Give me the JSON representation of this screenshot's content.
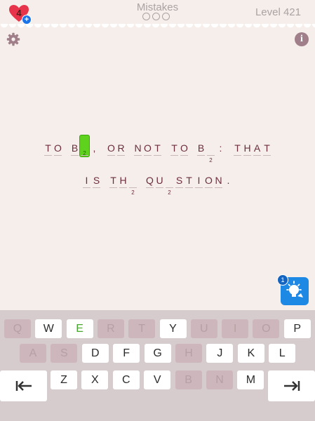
{
  "header": {
    "lives": "4",
    "plus": "+",
    "mistakes_label": "Mistakes",
    "level_label": "Level 421"
  },
  "info_label": "i",
  "hint_count": "1",
  "puzzle": {
    "line1": [
      {
        "c": "T"
      },
      {
        "c": "O"
      },
      {
        "gap": true
      },
      {
        "c": "B"
      },
      {
        "c": "",
        "sel": true,
        "num": "2"
      },
      {
        "c": ","
      },
      {
        "gap": true
      },
      {
        "c": "O"
      },
      {
        "c": "R"
      },
      {
        "gap": true
      },
      {
        "c": "N"
      },
      {
        "c": "O"
      },
      {
        "c": "T"
      },
      {
        "gap": true
      },
      {
        "c": "T"
      },
      {
        "c": "O"
      },
      {
        "gap": true
      },
      {
        "c": "B"
      },
      {
        "c": "",
        "num": "2"
      },
      {
        "c": ":"
      },
      {
        "gap": true
      },
      {
        "c": "T"
      },
      {
        "c": "H"
      },
      {
        "c": "A"
      },
      {
        "c": "T"
      }
    ],
    "line2": [
      {
        "c": "I"
      },
      {
        "c": "S"
      },
      {
        "gap": true
      },
      {
        "c": "T"
      },
      {
        "c": "H"
      },
      {
        "c": "",
        "num": "2"
      },
      {
        "gap": true
      },
      {
        "c": "Q"
      },
      {
        "c": "U"
      },
      {
        "c": "",
        "num": "2"
      },
      {
        "c": "S"
      },
      {
        "c": "T"
      },
      {
        "c": "I"
      },
      {
        "c": "O"
      },
      {
        "c": "N"
      },
      {
        "c": "."
      }
    ]
  },
  "keyboard": {
    "row1": [
      {
        "k": "Q",
        "s": "off"
      },
      {
        "k": "W",
        "s": "on"
      },
      {
        "k": "E",
        "s": "good"
      },
      {
        "k": "R",
        "s": "off"
      },
      {
        "k": "T",
        "s": "off"
      },
      {
        "k": "Y",
        "s": "on"
      },
      {
        "k": "U",
        "s": "off"
      },
      {
        "k": "I",
        "s": "off"
      },
      {
        "k": "O",
        "s": "off"
      },
      {
        "k": "P",
        "s": "on"
      }
    ],
    "row2": [
      {
        "k": "A",
        "s": "off"
      },
      {
        "k": "S",
        "s": "off"
      },
      {
        "k": "D",
        "s": "on"
      },
      {
        "k": "F",
        "s": "on"
      },
      {
        "k": "G",
        "s": "on"
      },
      {
        "k": "H",
        "s": "off"
      },
      {
        "k": "J",
        "s": "on"
      },
      {
        "k": "K",
        "s": "on"
      },
      {
        "k": "L",
        "s": "on"
      }
    ],
    "row3": [
      {
        "k": "Z",
        "s": "on"
      },
      {
        "k": "X",
        "s": "on"
      },
      {
        "k": "C",
        "s": "on"
      },
      {
        "k": "V",
        "s": "on"
      },
      {
        "k": "B",
        "s": "off"
      },
      {
        "k": "N",
        "s": "off"
      },
      {
        "k": "M",
        "s": "on"
      }
    ],
    "prev_icon": "arrow-to-left-icon",
    "next_icon": "arrow-to-right-icon"
  },
  "colors": {
    "background": "#f5eeeb",
    "letters": "#6b2d3c",
    "selected": "#5fd21d",
    "hint": "#1e88e5",
    "keyboard": "#d6ccce"
  }
}
